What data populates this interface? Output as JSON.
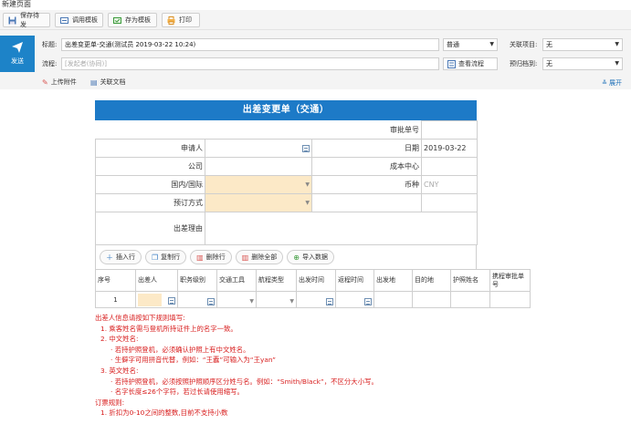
{
  "page": {
    "title": "新建页面"
  },
  "toolbar": {
    "save_draft": "保存待发",
    "use_template": "调用模板",
    "save_as_template": "存为模板",
    "print": "打印"
  },
  "header": {
    "send_label": "发送",
    "subject_label": "标题:",
    "subject_value": "出差变更单-交通(测试员 2019-03-22 10:24)",
    "flow_label": "流程:",
    "flow_placeholder": "[发起者(协同)]",
    "importance_value": "普通",
    "related_project_label": "关联项目:",
    "related_project_value": "无",
    "view_flow_label": "查看流程",
    "archive_label": "预归档到:",
    "archive_value": "无",
    "upload_label": "上传附件",
    "related_doc_label": "关联文档",
    "expand_label": "展开"
  },
  "form": {
    "title": "出差变更单（交通）",
    "approval_no_label": "审批单号",
    "applicant_label": "申请人",
    "date_label": "日期",
    "date_value": "2019-03-22",
    "company_label": "公司",
    "cost_center_label": "成本中心",
    "domestic_label": "国内/国际",
    "currency_label": "币种",
    "currency_value": "CNY",
    "booking_label": "预订方式",
    "reason_label": "出差理由",
    "buttons": {
      "insert": "插入行",
      "copy": "复制行",
      "delete": "删除行",
      "delete_all": "删除全部",
      "import": "导入数据"
    },
    "columns": [
      "序号",
      "出差人",
      "职务级别",
      "交通工具",
      "航程类型",
      "出发时间",
      "返程时间",
      "出发地",
      "目的地",
      "护照姓名",
      "携程审批单号"
    ],
    "row_no": "1"
  },
  "rules": [
    "出差人信息请按如下规则填写:",
    "1. 乘客姓名需与登机所持证件上的名字一致。",
    "2. 中文姓名:",
    "· 若持护照登机，必须确认护照上有中文姓名。",
    "· 生僻字可用拼音代替，例如：“王蠹”可输入为“王yan”",
    "3. 英文姓名:",
    "· 若持护照登机，必须按照护照顺序区分姓与名。例如：“Smith/Black”，不区分大小写。",
    "· 名字长度≤26个字符，若过长请使用缩写。",
    "订票规则:",
    "1. 折扣为0-10之间的整数,目前不支持小数"
  ],
  "colors": {
    "accent": "#1d7ac7",
    "rules_red": "#d81e1e",
    "input_highlight": "#fce9c7"
  }
}
